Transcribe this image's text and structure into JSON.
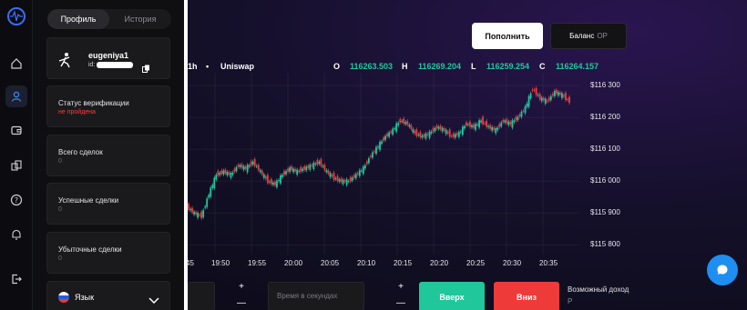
{
  "panel": {
    "tabs": [
      {
        "label": "Профиль",
        "active": true
      },
      {
        "label": "История",
        "active": false
      }
    ],
    "user": {
      "name": "eugeniya1",
      "id_prefix": "id:"
    },
    "verification": {
      "title": "Статус верификации",
      "value": "не пройдена"
    },
    "total_deals": {
      "title": "Всего сделок",
      "value": "0"
    },
    "successful_deals": {
      "title": "Успешные сделки",
      "value": "0"
    },
    "losing_deals": {
      "title": "Убыточные сделки",
      "value": "0"
    },
    "language": {
      "label": "Язык"
    }
  },
  "header": {
    "topup_label": "Пополнить",
    "balance_label": "Баланс",
    "balance_currency": "OP"
  },
  "chart": {
    "timeframe": "1h",
    "source": "Uniswap",
    "ohlc": {
      "o_label": "O",
      "o": "116263.503",
      "h_label": "H",
      "h": "116269.204",
      "l_label": "L",
      "l": "116259.254",
      "c_label": "C",
      "c": "116264.157"
    },
    "up_color": "#22c7a0",
    "down_color": "#ef3a3a"
  },
  "chart_data": {
    "type": "line",
    "y_tick_labels": [
      "$116 300",
      "$116 200",
      "$116 100",
      "$116 000",
      "$115 900",
      "$115 800"
    ],
    "y_ticks": [
      116300,
      116200,
      116100,
      116000,
      115900,
      115800
    ],
    "x_tick_labels": [
      "45",
      "19:50",
      "19:55",
      "20:00",
      "20:05",
      "20:10",
      "20:15",
      "20:20",
      "20:25",
      "20:30",
      "20:35"
    ],
    "ylim": [
      115770,
      116340
    ],
    "x": [
      "19:45",
      "19:46",
      "19:47",
      "19:48",
      "19:49",
      "19:50",
      "19:51",
      "19:52",
      "19:53",
      "19:54",
      "19:55",
      "19:56",
      "19:57",
      "19:58",
      "19:59",
      "20:00",
      "20:01",
      "20:02",
      "20:03",
      "20:04",
      "20:05",
      "20:06",
      "20:07",
      "20:08",
      "20:09",
      "20:10",
      "20:11",
      "20:12",
      "20:13",
      "20:14",
      "20:15",
      "20:16",
      "20:17",
      "20:18",
      "20:19",
      "20:20",
      "20:21",
      "20:22",
      "20:23",
      "20:24",
      "20:25",
      "20:26",
      "20:27",
      "20:28",
      "20:29",
      "20:30",
      "20:31",
      "20:32",
      "20:33",
      "20:34",
      "20:35",
      "20:36",
      "20:37"
    ],
    "values": [
      115920,
      115900,
      115890,
      115960,
      116020,
      116030,
      116020,
      116050,
      116040,
      116060,
      116030,
      116000,
      115990,
      116020,
      116040,
      116030,
      116040,
      116050,
      116060,
      116030,
      116010,
      116000,
      116000,
      116020,
      116040,
      116080,
      116110,
      116140,
      116160,
      116190,
      116180,
      116150,
      116140,
      116150,
      116170,
      116160,
      116140,
      116150,
      116180,
      116170,
      116190,
      116170,
      116160,
      116190,
      116180,
      116200,
      116230,
      116290,
      116260,
      116250,
      116280,
      116270,
      116250
    ],
    "grid": true
  },
  "controls": {
    "time_placeholder": "Время в секундах",
    "plus": "+",
    "minus": "—",
    "up_label": "Вверх",
    "down_label": "Вниз",
    "income_label": "Возможный доход",
    "income_value": "P"
  }
}
